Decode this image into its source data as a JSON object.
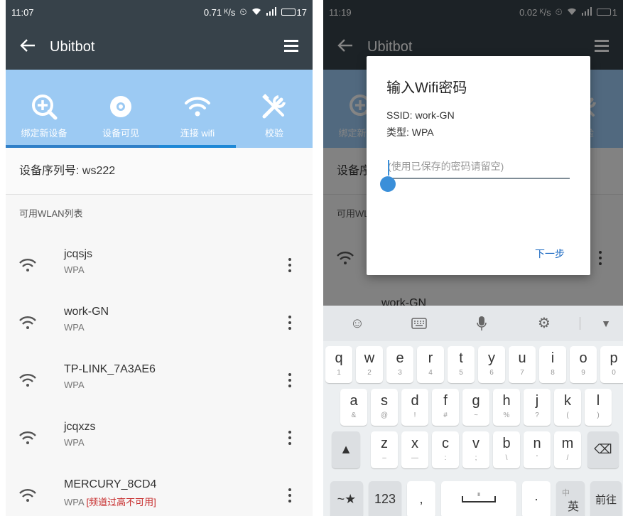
{
  "left_screen": {
    "status": {
      "time": "11:07",
      "speed": "0.71 ᴷ/s",
      "battery": "17"
    },
    "appbar": {
      "title": "Ubitbot"
    },
    "tabs": [
      {
        "label": "绑定新设备",
        "icon": "add-circle-icon"
      },
      {
        "label": "设备可见",
        "icon": "target-icon"
      },
      {
        "label": "连接 wifi",
        "icon": "wifi-icon"
      },
      {
        "label": "校验",
        "icon": "tools-icon"
      }
    ],
    "active_tab": "连接 wifi",
    "serial": "设备序列号: ws222",
    "section_header": "可用WLAN列表",
    "networks": [
      {
        "ssid": "jcqsjs",
        "security": "WPA"
      },
      {
        "ssid": "work-GN",
        "security": "WPA"
      },
      {
        "ssid": "TP-LINK_7A3AE6",
        "security": "WPA"
      },
      {
        "ssid": "jcqxzs",
        "security": "WPA"
      },
      {
        "ssid": "MERCURY_8CD4",
        "security": "WPA ",
        "warning": "[频道过高不可用]"
      }
    ]
  },
  "right_screen": {
    "status": {
      "time": "11:19",
      "speed": "0.02 ᴷ/s",
      "battery": "1"
    },
    "appbar": {
      "title": "Ubitbot"
    },
    "dialog": {
      "title": "输入Wifi密码",
      "ssid": "SSID: work-GN",
      "type": "类型: WPA",
      "placeholder": "(使用已保存的密码请留空)",
      "next": "下一步"
    },
    "keyboard": {
      "row1": [
        {
          "k": "q",
          "s": "1"
        },
        {
          "k": "w",
          "s": "2"
        },
        {
          "k": "e",
          "s": "3"
        },
        {
          "k": "r",
          "s": "4"
        },
        {
          "k": "t",
          "s": "5"
        },
        {
          "k": "y",
          "s": "6"
        },
        {
          "k": "u",
          "s": "7"
        },
        {
          "k": "i",
          "s": "8"
        },
        {
          "k": "o",
          "s": "9"
        },
        {
          "k": "p",
          "s": "0"
        }
      ],
      "row2": [
        {
          "k": "a",
          "s": "&"
        },
        {
          "k": "s",
          "s": "@"
        },
        {
          "k": "d",
          "s": "!"
        },
        {
          "k": "f",
          "s": "#"
        },
        {
          "k": "g",
          "s": "~"
        },
        {
          "k": "h",
          "s": "%"
        },
        {
          "k": "j",
          "s": "?"
        },
        {
          "k": "k",
          "s": "("
        },
        {
          "k": "l",
          "s": ")"
        }
      ],
      "row3": [
        {
          "k": "z",
          "s": "–"
        },
        {
          "k": "x",
          "s": "—"
        },
        {
          "k": "c",
          "s": ":"
        },
        {
          "k": "v",
          "s": ";"
        },
        {
          "k": "b",
          "s": "\\"
        },
        {
          "k": "n",
          "s": "'"
        },
        {
          "k": "m",
          "s": "/"
        }
      ],
      "symbols": "~★",
      "numbers": "123",
      "comma": ",",
      "period": "·",
      "lang_top": "中",
      "lang_bottom": "英",
      "go": "前往",
      "partial_list_text": "work-GN"
    }
  },
  "colors": {
    "appbar": "#37424a",
    "tabs_bg": "#9ccaf3",
    "accent": "#1e88d6",
    "warning": "#c62828"
  }
}
